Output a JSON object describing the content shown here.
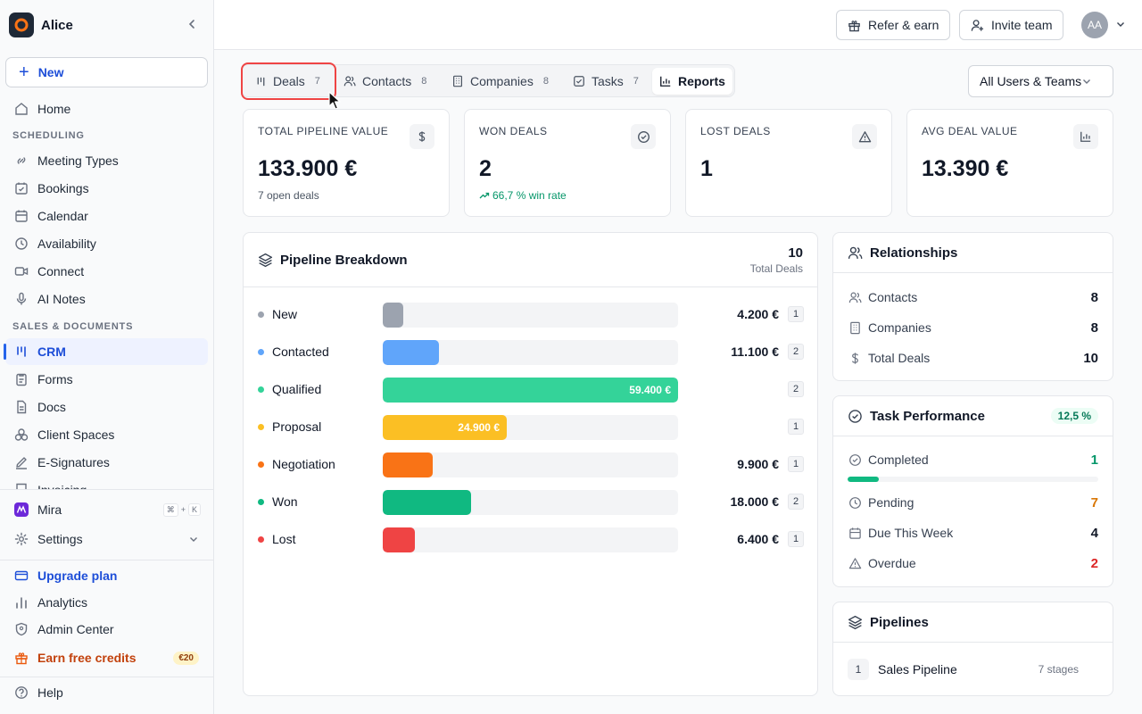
{
  "workspace": {
    "name": "Alice"
  },
  "sidebar": {
    "new_label": "New",
    "home": "Home",
    "section_scheduling": "SCHEDULING",
    "scheduling_items": [
      "Meeting Types",
      "Bookings",
      "Calendar",
      "Availability",
      "Connect",
      "AI Notes"
    ],
    "section_sales": "SALES & DOCUMENTS",
    "sales_items": [
      "CRM",
      "Forms",
      "Docs",
      "Client Spaces",
      "E-Signatures",
      "Invoicing"
    ],
    "mira": "Mira",
    "mira_shortcut": [
      "⌘",
      "+",
      "K"
    ],
    "settings": "Settings",
    "upgrade": "Upgrade plan",
    "analytics": "Analytics",
    "admin": "Admin Center",
    "earn": "Earn free credits",
    "earn_badge": "€20",
    "help": "Help"
  },
  "topbar": {
    "refer": "Refer & earn",
    "invite": "Invite team",
    "avatar": "AA"
  },
  "tabs": [
    {
      "label": "Deals",
      "count": "7"
    },
    {
      "label": "Contacts",
      "count": "8"
    },
    {
      "label": "Companies",
      "count": "8"
    },
    {
      "label": "Tasks",
      "count": "7"
    },
    {
      "label": "Reports",
      "count": ""
    }
  ],
  "filter": {
    "value": "All Users & Teams"
  },
  "stats": [
    {
      "label": "TOTAL PIPELINE VALUE",
      "value": "133.900 €",
      "sub": "7 open deals"
    },
    {
      "label": "WON DEALS",
      "value": "2",
      "sub": "66,7 % win rate"
    },
    {
      "label": "LOST DEALS",
      "value": "1",
      "sub": ""
    },
    {
      "label": "AVG DEAL VALUE",
      "value": "13.390 €",
      "sub": ""
    }
  ],
  "pipeline": {
    "title": "Pipeline Breakdown",
    "total": "10",
    "total_label": "Total Deals",
    "stages": [
      {
        "name": "New",
        "amount": "4.200 €",
        "count": "1",
        "share": 0.07,
        "color": "#9ca3af",
        "inside": false
      },
      {
        "name": "Contacted",
        "amount": "11.100 €",
        "count": "2",
        "share": 0.19,
        "color": "#60a5fa",
        "inside": false
      },
      {
        "name": "Qualified",
        "amount": "59.400 €",
        "count": "2",
        "share": 1.0,
        "color": "#34d399",
        "inside": true
      },
      {
        "name": "Proposal",
        "amount": "24.900 €",
        "count": "1",
        "share": 0.42,
        "color": "#fbbf24",
        "inside": true
      },
      {
        "name": "Negotiation",
        "amount": "9.900 €",
        "count": "1",
        "share": 0.17,
        "color": "#f97316",
        "inside": false
      },
      {
        "name": "Won",
        "amount": "18.000 €",
        "count": "2",
        "share": 0.3,
        "color": "#10b981",
        "inside": false
      },
      {
        "name": "Lost",
        "amount": "6.400 €",
        "count": "1",
        "share": 0.11,
        "color": "#ef4444",
        "inside": false
      }
    ]
  },
  "relationships": {
    "title": "Relationships",
    "contacts_label": "Contacts",
    "contacts": "8",
    "companies_label": "Companies",
    "companies": "8",
    "deals_label": "Total Deals",
    "deals": "10"
  },
  "tasks": {
    "title": "Task Performance",
    "badge": "12,5 %",
    "completed_label": "Completed",
    "completed": "1",
    "completion_fraction": 0.125,
    "pending_label": "Pending",
    "pending": "7",
    "due_label": "Due This Week",
    "due": "4",
    "overdue_label": "Overdue",
    "overdue": "2"
  },
  "pipelines": {
    "title": "Pipelines",
    "items": [
      {
        "index": "1",
        "name": "Sales Pipeline",
        "stages": "7 stages"
      }
    ]
  },
  "colors": {
    "accent": "#2563eb",
    "highlight": "#ef4444",
    "success": "#059669",
    "warning": "#d97706",
    "danger": "#dc2626"
  }
}
